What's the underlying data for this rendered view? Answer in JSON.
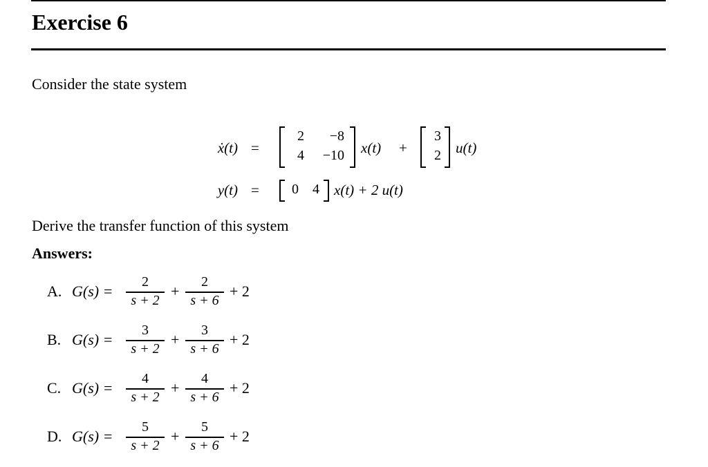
{
  "title": "Exercise 6",
  "intro": "Consider the state system",
  "equations": {
    "state": {
      "lhs": "ẋ(t)",
      "eq": "=",
      "A": [
        [
          "2",
          "−8"
        ],
        [
          "4",
          "−10"
        ]
      ],
      "x": "x(t)",
      "plus": "+",
      "B": [
        "3",
        "2"
      ],
      "u": "u(t)"
    },
    "output": {
      "lhs": "y(t)",
      "eq": "=",
      "C": [
        "0",
        "4"
      ],
      "rest": "x(t) + 2 u(t)"
    }
  },
  "question": "Derive the transfer function of this system",
  "answers_heading": "Answers:",
  "options": [
    {
      "label": "A.",
      "g": "G(s) =",
      "num1": "2",
      "den1": "s + 2",
      "plus": "+",
      "num2": "2",
      "den2": "s + 6",
      "tail": "+ 2"
    },
    {
      "label": "B.",
      "g": "G(s) =",
      "num1": "3",
      "den1": "s + 2",
      "plus": "+",
      "num2": "3",
      "den2": "s + 6",
      "tail": "+ 2"
    },
    {
      "label": "C.",
      "g": "G(s) =",
      "num1": "4",
      "den1": "s + 2",
      "plus": "+",
      "num2": "4",
      "den2": "s + 6",
      "tail": "+ 2"
    },
    {
      "label": "D.",
      "g": "G(s) =",
      "num1": "5",
      "den1": "s + 2",
      "plus": "+",
      "num2": "5",
      "den2": "s + 6",
      "tail": "+ 2"
    }
  ]
}
